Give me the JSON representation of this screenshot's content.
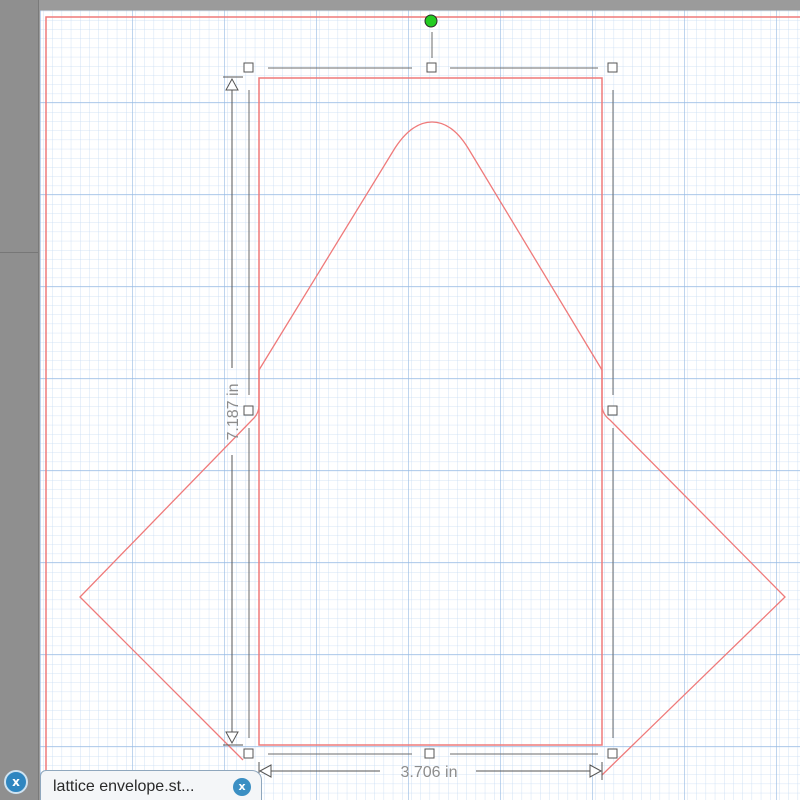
{
  "document": {
    "tab_label": "lattice envelope.st...",
    "tab_close_glyph": "x",
    "close_all_glyph": "x"
  },
  "dimensions": {
    "height_label": "7.187 in",
    "width_label": "3.706 in"
  },
  "colors": {
    "grid_minor": "#c7dcf3",
    "grid_major": "#94b9e3",
    "cut_line": "#ef7a7a",
    "rotate_handle": "#22cc22",
    "tab_close": "#3b8fc3"
  },
  "icons": {
    "rotate_handle": "rotation-handle-icon",
    "selection_handles": "resize-handle-icon",
    "tab_close": "close-icon"
  }
}
